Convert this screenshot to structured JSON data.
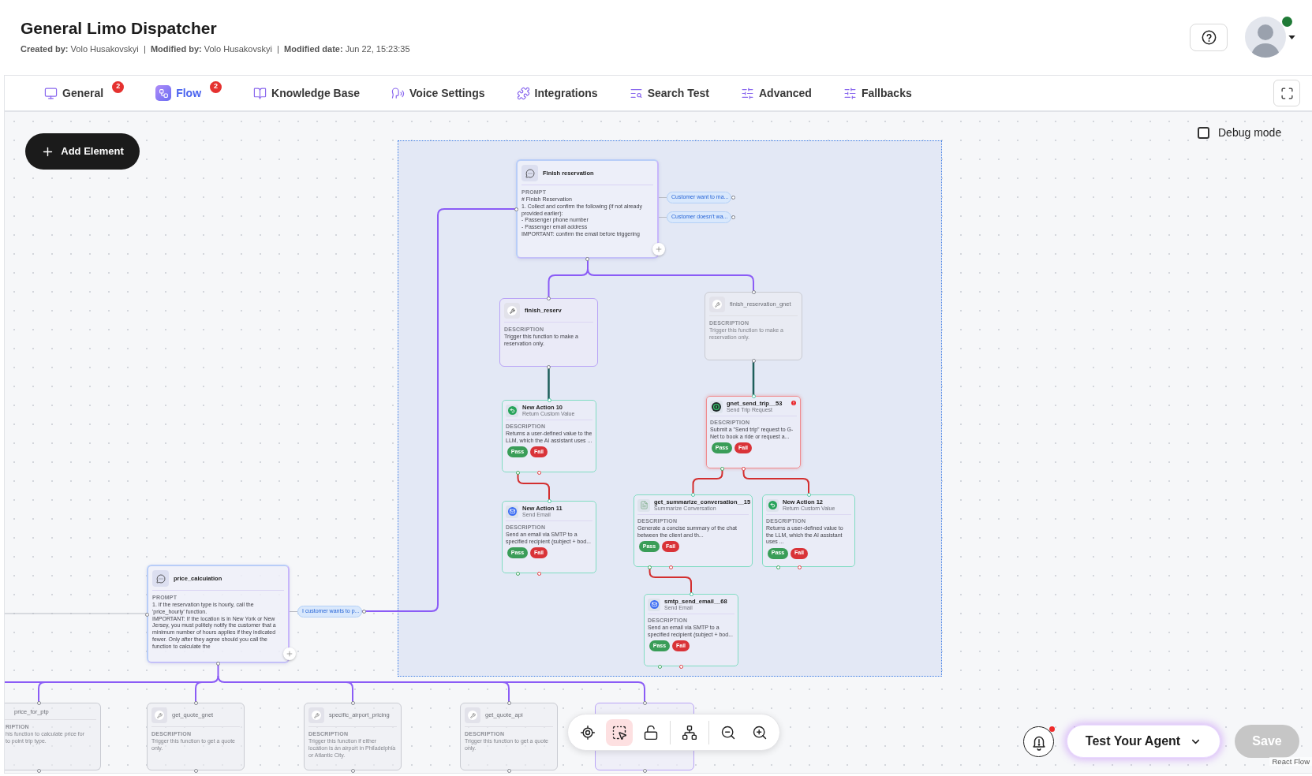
{
  "header": {
    "title": "General Limo Dispatcher",
    "meta": "**Created by:** Volo Husakovskyi  |  **Modified by:** Volo Husakovskyi  |  **Modified date:** Jun 22, 15:23:35",
    "user": {
      "online": true
    }
  },
  "tabs": [
    {
      "kind": "general",
      "label": "General",
      "badge": "2",
      "selected": false
    },
    {
      "kind": "flow",
      "label": "Flow",
      "badge": "2",
      "selected": true
    },
    {
      "kind": "knowledge",
      "label": "Knowledge Base",
      "selected": false
    },
    {
      "kind": "voice",
      "label": "Voice Settings",
      "selected": false
    },
    {
      "kind": "integrations",
      "label": "Integrations",
      "selected": false
    },
    {
      "kind": "search",
      "label": "Search Test",
      "selected": false
    },
    {
      "kind": "advanced",
      "label": "Advanced",
      "selected": false
    },
    {
      "kind": "fallbacks",
      "label": "Fallbacks",
      "selected": false
    }
  ],
  "canvas": {
    "add_element": "Add Element",
    "debug_mode": {
      "label": "Debug mode",
      "checked": false
    },
    "nodes": [
      {
        "kind": "prompt",
        "title": "Finish reservation",
        "section": "PROMPT",
        "text": "# Finish Reservation\n1. Collect and confirm the following (if not already provided earlier):\n- Passenger phone number\n- Passenger email address\nIMPORTANT: confirm the email before triggering",
        "branches": [
          "Customer want to ma...",
          "Customer doesn't wa..."
        ]
      },
      {
        "kind": "function",
        "title": "finish_reserv",
        "section": "DESCRIPTION",
        "text": "Trigger this function to make a reservation only.",
        "disabled": false
      },
      {
        "kind": "function",
        "title": "finish_reservation_gnet",
        "section": "DESCRIPTION",
        "text": "Trigger this function to make a reservation only.",
        "disabled": true
      },
      {
        "kind": "return",
        "title": "New Action 10",
        "subtitle": "Return Custom Value",
        "section": "DESCRIPTION",
        "text": "Returns a user-defined value to the LLM, which the AI assistant uses ...",
        "pass": "Pass",
        "fail": "Fail",
        "error": false
      },
      {
        "kind": "trip",
        "title": "gnet_send_trip__53",
        "subtitle": "Send Trip Request",
        "section": "DESCRIPTION",
        "text": "Submit a \"Send trip\" request to G-Net to book a ride or request a...",
        "pass": "Pass",
        "fail": "Fail",
        "error": true
      },
      {
        "kind": "email",
        "title": "New Action 11",
        "subtitle": "Send Email",
        "section": "DESCRIPTION",
        "text": "Send an email via SMTP to a specified recipient (subject + bod...",
        "pass": "Pass",
        "fail": "Fail",
        "error": false
      },
      {
        "kind": "summary",
        "title": "get_summarize_conversation__15",
        "subtitle": "Summarize Conversation",
        "section": "DESCRIPTION",
        "text": "Generate a concise summary of the chat between the client and th...",
        "pass": "Pass",
        "fail": "Fail",
        "error": false
      },
      {
        "kind": "return",
        "title": "New Action 12",
        "subtitle": "Return Custom Value",
        "section": "DESCRIPTION",
        "text": "Returns a user-defined value to the LLM, which the AI assistant uses ...",
        "pass": "Pass",
        "fail": "Fail",
        "error": false
      },
      {
        "kind": "prompt",
        "title": "price_calculation",
        "section": "PROMPT",
        "text": "1. If the reservation type is hourly, call the 'price_hourly' function.\nIMPORTANT: If the location is in New York or New Jersey, you must politely notify the customer that a minimum number of hours applies if they indicated fewer. Only after they agree should you call the function to calculate the",
        "branches": [
          "I customer wants to p..."
        ]
      },
      {
        "kind": "email",
        "title": "smtp_send_email__68",
        "subtitle": "Send Email",
        "section": "DESCRIPTION",
        "text": "Send an email via SMTP to a specified recipient (subject + bod...",
        "pass": "Pass",
        "fail": "Fail",
        "error": false
      },
      {
        "kind": "function",
        "title": "price_for_ptp",
        "section": "RIPTION",
        "text": "his function to calculate price for\nto point trip type.",
        "disabled": true
      },
      {
        "kind": "function",
        "title": "get_quote_gnet",
        "section": "DESCRIPTION",
        "text": "Trigger this function to get a quote only.",
        "disabled": true
      },
      {
        "kind": "function",
        "title": "specific_airport_pricing",
        "section": "DESCRIPTION",
        "text": "Trigger this function if either location is an airport in Philadelphia or Atlantic City.",
        "disabled": true
      },
      {
        "kind": "function",
        "title": "get_quote_api",
        "section": "DESCRIPTION",
        "text": "Trigger this function to get a quote only.",
        "disabled": true
      },
      {
        "kind": "function",
        "disabled": false
      }
    ],
    "toolbar": [
      {
        "kind": "fit",
        "selected": false
      },
      {
        "kind": "select",
        "selected": true
      },
      {
        "kind": "lock",
        "selected": false
      },
      {
        "kind": "layout",
        "selected": false
      },
      {
        "kind": "zoom_out",
        "selected": false
      },
      {
        "kind": "zoom_in",
        "selected": false
      }
    ],
    "attribution": "React Flow"
  },
  "footer": {
    "notifications": {
      "unread": true
    },
    "test_button": "Test Your Agent",
    "save_button": {
      "label": "Save",
      "disabled": true
    }
  }
}
